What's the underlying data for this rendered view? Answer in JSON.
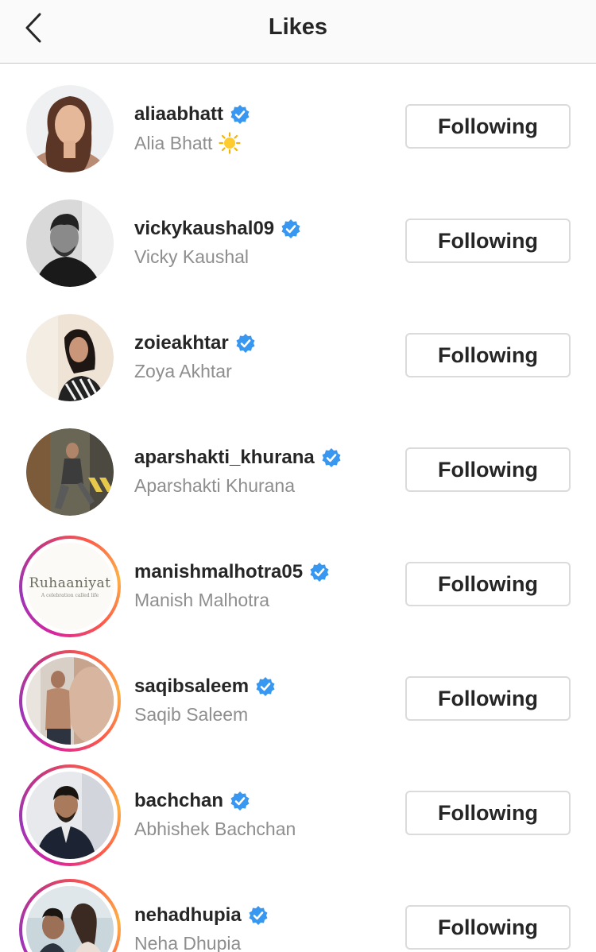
{
  "header": {
    "title": "Likes",
    "back_icon": "chevron-left-icon"
  },
  "users": [
    {
      "username": "aliaabhatt",
      "fullname": "Alia Bhatt",
      "emoji": "sun",
      "verified": true,
      "button": "Following",
      "story_ring": false
    },
    {
      "username": "vickykaushal09",
      "fullname": "Vicky Kaushal",
      "verified": true,
      "button": "Following",
      "story_ring": false
    },
    {
      "username": "zoieakhtar",
      "fullname": "Zoya Akhtar",
      "verified": true,
      "button": "Following",
      "story_ring": false
    },
    {
      "username": "aparshakti_khurana",
      "fullname": "Aparshakti Khurana",
      "verified": true,
      "button": "Following",
      "story_ring": false
    },
    {
      "username": "manishmalhotra05",
      "fullname": "Manish Malhotra",
      "verified": true,
      "button": "Following",
      "story_ring": true,
      "avatar_text": "Ruhaaniyat",
      "avatar_subtext": "A celebration called life"
    },
    {
      "username": "saqibsaleem",
      "fullname": "Saqib Saleem",
      "verified": true,
      "button": "Following",
      "story_ring": true
    },
    {
      "username": "bachchan",
      "fullname": "Abhishek Bachchan",
      "verified": true,
      "button": "Following",
      "story_ring": true
    },
    {
      "username": "nehadhupia",
      "fullname": "Neha Dhupia",
      "verified": true,
      "button": "Following",
      "story_ring": true
    }
  ],
  "colors": {
    "verified_blue": "#3897f0",
    "secondary_text": "#8e8e8e",
    "button_border": "#dbdbdb"
  }
}
